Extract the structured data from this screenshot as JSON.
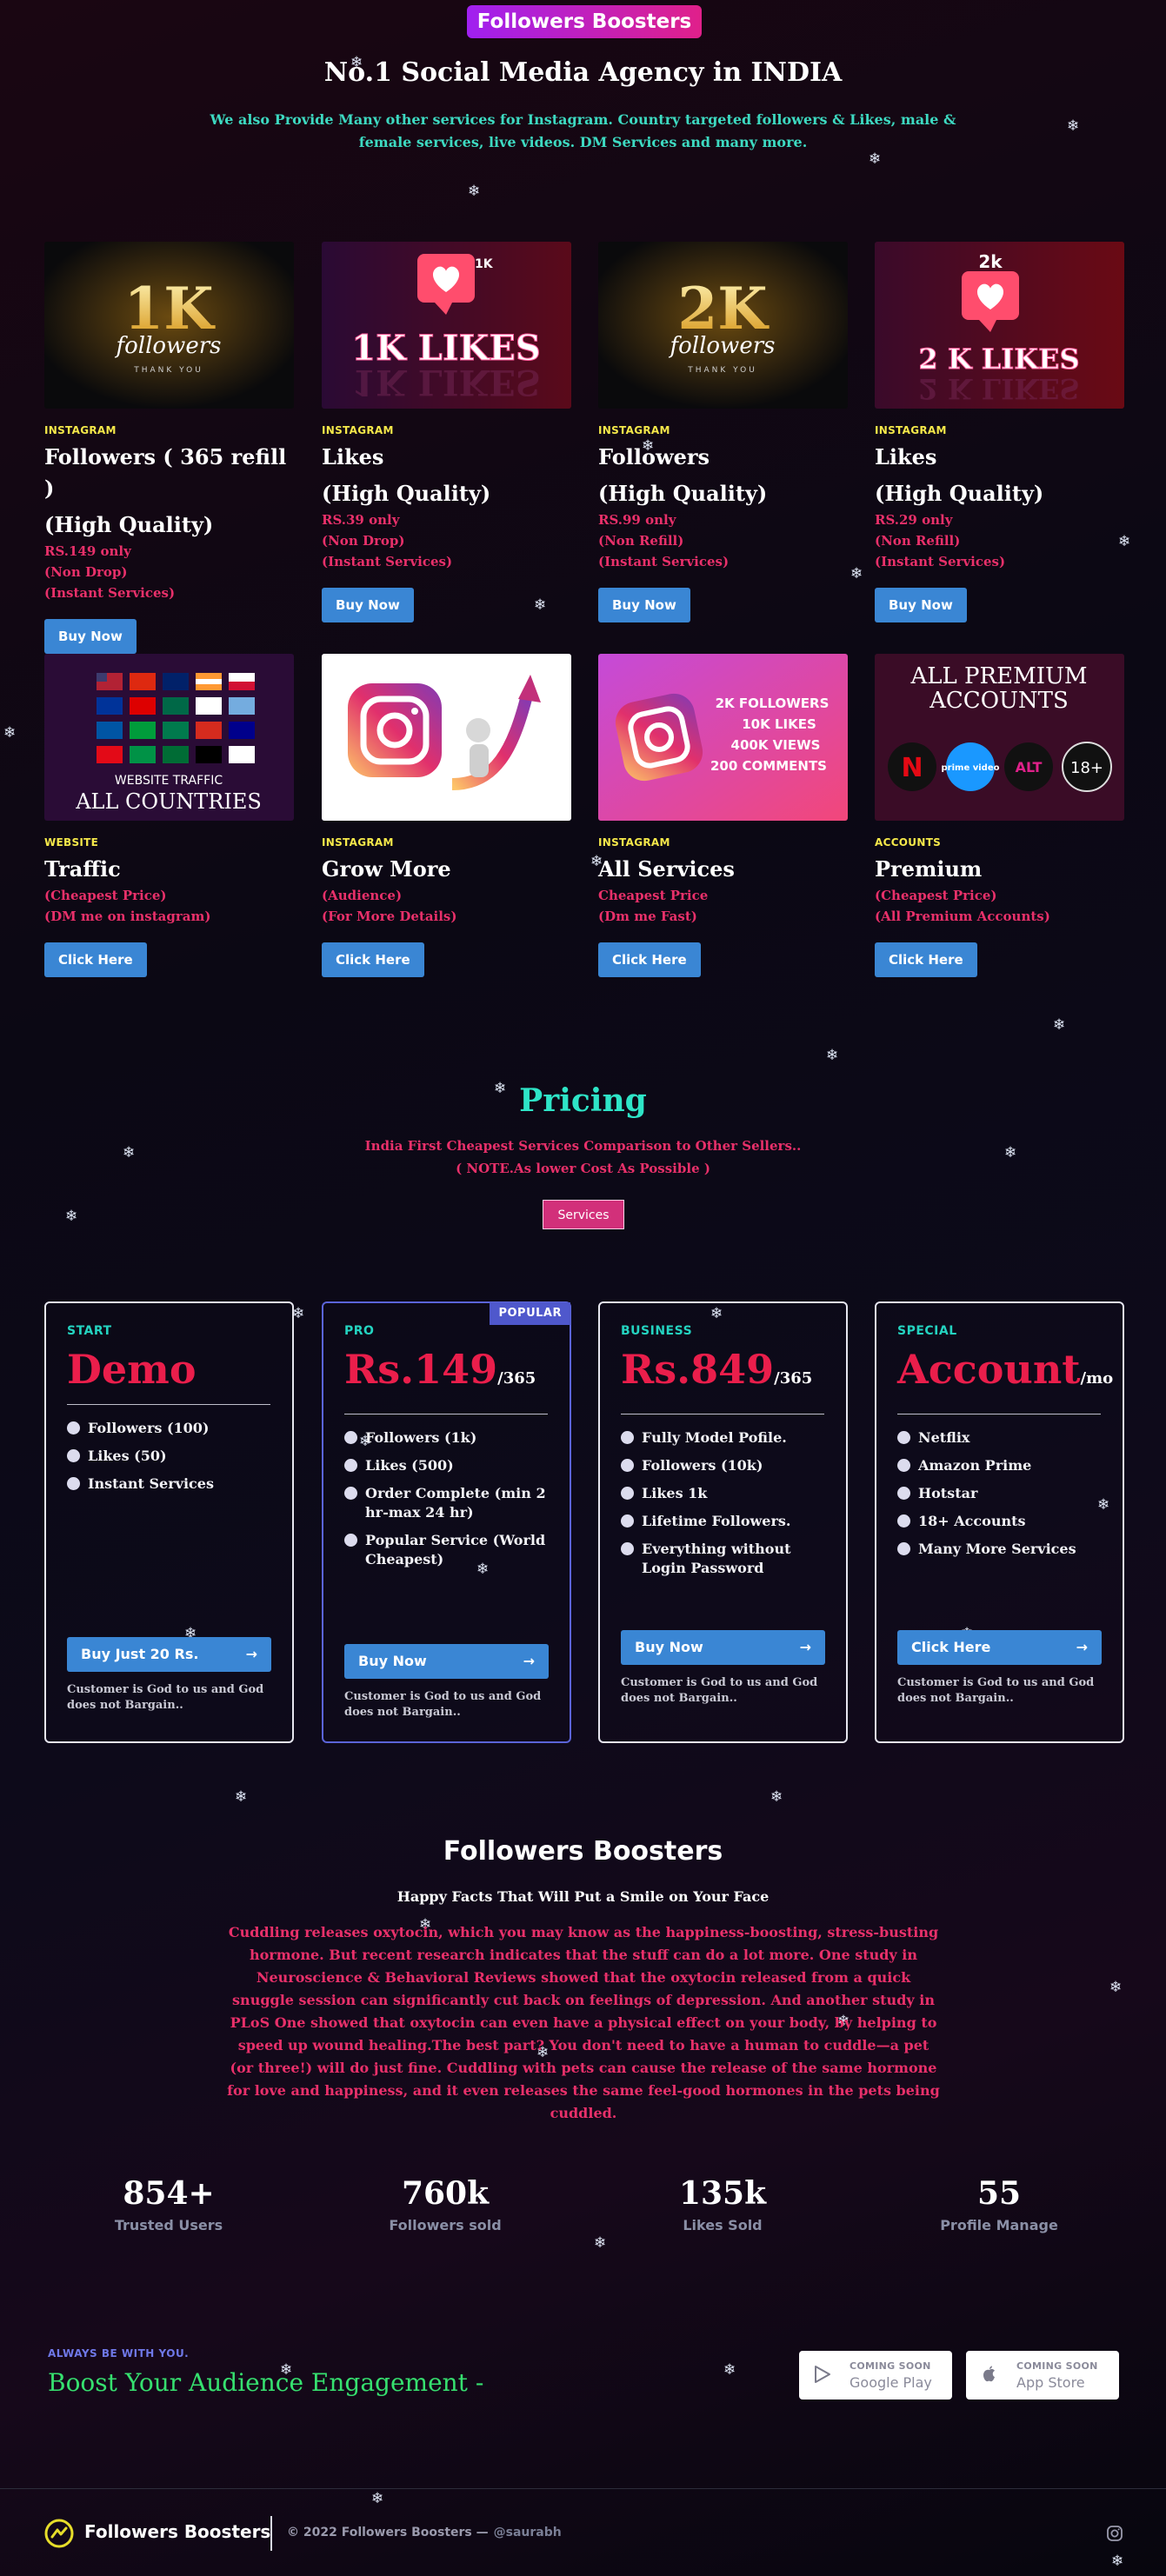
{
  "header": {
    "brand_badge": "Followers Boosters",
    "title": "No.1 Social Media Agency in INDIA",
    "subtitle": "We also Provide Many other services for Instagram. Country targeted followers & Likes, male & female services, live videos. DM Services and many more."
  },
  "products": [
    {
      "category": "INSTAGRAM",
      "name": "Followers ( 365 refill )",
      "name2": "(High Quality)",
      "lines": [
        "RS.149 only",
        "(Non Drop)",
        "(Instant Services)"
      ],
      "button": "Buy Now",
      "thumb": {
        "big": "1K",
        "script": "followers",
        "small": "THANK YOU"
      }
    },
    {
      "category": "INSTAGRAM",
      "name": "Likes",
      "name2": "(High Quality)",
      "lines": [
        "RS.39 only",
        "(Non Drop)",
        "(Instant Services)"
      ],
      "button": "Buy Now",
      "thumb": {
        "badge": "1K",
        "text": "1K LIKES"
      }
    },
    {
      "category": "INSTAGRAM",
      "name": "Followers",
      "name2": "(High Quality)",
      "lines": [
        "RS.99 only",
        "(Non Refill)",
        "(Instant Services)"
      ],
      "button": "Buy Now",
      "thumb": {
        "big": "2K",
        "script": "followers",
        "small": "THANK YOU"
      }
    },
    {
      "category": "INSTAGRAM",
      "name": "Likes",
      "name2": "(High Quality)",
      "lines": [
        "RS.29 only",
        "(Non Refill)",
        "(Instant Services)"
      ],
      "button": "Buy Now",
      "thumb": {
        "badge": "2k",
        "text": "2 K LIKES"
      }
    },
    {
      "category": "WEBSITE",
      "name": "Traffic",
      "name2": "",
      "lines": [
        "(Cheapest Price)",
        "(DM me on instagram)"
      ],
      "button": "Click Here",
      "thumb": {
        "t1": "WEBSITE  TRAFFIC",
        "t2": "ALL COUNTRIES"
      }
    },
    {
      "category": "INSTAGRAM",
      "name": "Grow More",
      "name2": "",
      "lines": [
        "(Audience)",
        "(For More Details)"
      ],
      "button": "Click Here",
      "thumb": {}
    },
    {
      "category": "INSTAGRAM",
      "name": "All Services",
      "name2": "",
      "lines": [
        "Cheapest Price",
        "(Dm me Fast)"
      ],
      "button": "Click Here",
      "thumb": {
        "l1": "2K FOLLOWERS",
        "l2": "10K LIKES",
        "l3": "400K VIEWS",
        "l4": "200 COMMENTS"
      }
    },
    {
      "category": "ACCOUNTS",
      "name": "Premium",
      "name2": "",
      "lines": [
        "(Cheapest Price)",
        "(All Premium Accounts)"
      ],
      "button": "Click Here",
      "thumb": {
        "t1": "ALL PREMIUM",
        "t2": "ACCOUNTS",
        "b1": "N",
        "b2": "prime video",
        "b3": "ALT",
        "b4": "18+"
      }
    }
  ],
  "pricing": {
    "title": "Pricing",
    "sub1": "India First Cheapest Services Comparison to Other Sellers..",
    "sub2": "( NOTE.As lower Cost As Possible )",
    "services_button": "Services",
    "plans": [
      {
        "tag": "START",
        "price": "Demo",
        "per": "",
        "features": [
          "Followers (100)",
          "Likes (50)",
          "Instant Services"
        ],
        "button": "Buy Just 20 Rs.",
        "note": "Customer is God to us and God does not Bargain.."
      },
      {
        "tag": "PRO",
        "ribbon": "POPULAR",
        "price": "Rs.149",
        "per": "/365",
        "features": [
          "Followers (1k)",
          "Likes (500)",
          "Order Complete (min 2 hr-max 24 hr)",
          "Popular Service (World Cheapest)"
        ],
        "button": "Buy Now",
        "note": "Customer is God to us and God does not Bargain.."
      },
      {
        "tag": "BUSINESS",
        "price": "Rs.849",
        "per": "/365",
        "features": [
          "Fully Model Pofile.",
          "Followers (10k)",
          "Likes 1k",
          "Lifetime Followers.",
          "Everything without Login Password"
        ],
        "button": "Buy Now",
        "note": "Customer is God to us and God does not Bargain.."
      },
      {
        "tag": "SPECIAL",
        "price": "Account",
        "per": "/mo",
        "features": [
          "Netflix",
          "Amazon Prime",
          "Hotstar",
          "18+ Accounts",
          "Many More Services"
        ],
        "button": "Click Here",
        "note": "Customer is God to us and God does not Bargain.."
      }
    ]
  },
  "facts": {
    "title": "Followers Boosters",
    "subtitle": "Happy Facts That Will Put a Smile on Your Face",
    "body": "Cuddling releases oxytocin, which you may know as the happiness-boosting, stress-busting hormone. But recent research indicates that the stuff can do a lot more. One study in Neuroscience & Behavioral Reviews showed that the oxytocin released from a quick snuggle session can significantly cut back on feelings of depression. And another study in PLoS One showed that oxytocin can even have a physical effect on your body, by helping to speed up wound healing.The best part? You don't need to have a human to cuddle—a pet (or three!) will do just fine. Cuddling with pets can cause the release of the same hormone for love and happiness, and it even releases the same feel-good hormones in the pets being cuddled."
  },
  "stats": [
    {
      "value": "854+",
      "label": "Trusted Users"
    },
    {
      "value": "760k",
      "label": "Followers sold"
    },
    {
      "value": "135k",
      "label": "Likes Sold"
    },
    {
      "value": "55",
      "label": "Profile Manage"
    }
  ],
  "cta": {
    "small": "ALWAYS BE WITH YOU.",
    "big": "Boost Your Audience Engagement -",
    "google": {
      "t1": "COMING SOON",
      "t2": "Google Play"
    },
    "apple": {
      "t1": "COMING SOON",
      "t2": "App Store"
    }
  },
  "footer": {
    "brand": "Followers Boosters",
    "copyright": "© 2022 Followers Boosters —",
    "handle": "@saurabh"
  },
  "colors": {
    "accent_pink": "#e8306a",
    "accent_teal": "#2ee5c7",
    "button_blue": "#3a86d4",
    "category_yellow": "#f5e84a"
  }
}
